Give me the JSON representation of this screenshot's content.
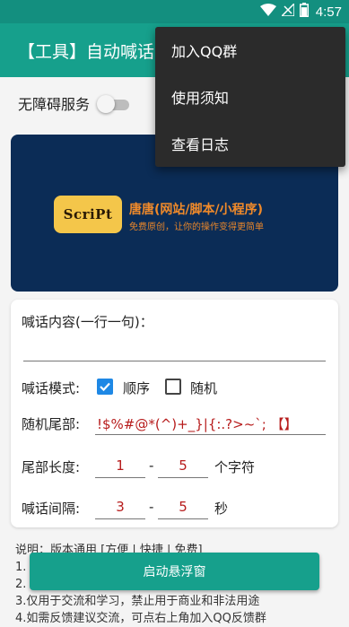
{
  "status_bar": {
    "time": "4:57",
    "battery_level": 0.75
  },
  "app_bar": {
    "title": "【工具】自动喊话"
  },
  "accessibility": {
    "label": "无障碍服务",
    "enabled": false
  },
  "banner": {
    "logo_text": "ScriPt",
    "title": "唐唐(网站/脚本/小程序)",
    "subtitle": "免费原创，让你的操作变得更简单"
  },
  "form": {
    "message_label": "喊话内容(一行一句)：",
    "message_value": "",
    "mode_label": "喊话模式:",
    "mode_options": [
      {
        "label": "顺序",
        "checked": true
      },
      {
        "label": "随机",
        "checked": false
      }
    ],
    "tail_label": "随机尾部:",
    "tail_value": "!$%#@*(^)+_}|{:.?>~`;  【】",
    "tail_length_label": "尾部长度:",
    "tail_length_min": "1",
    "tail_length_max": "5",
    "tail_length_unit": "个字符",
    "interval_label": "喊话间隔:",
    "interval_min": "3",
    "interval_max": "5",
    "interval_unit": "秒",
    "range_separator": "-"
  },
  "notes": [
    "说明：版本通用 [方便 | 快捷 | 免费]",
    "1.",
    "2.",
    "3.仅用于交流和学习，禁止用于商业和非法用途",
    "4.如需反馈建议交流，可点右上角加入QQ反馈群"
  ],
  "start_button": {
    "label": "启动悬浮窗"
  },
  "overflow_menu": {
    "items": [
      "加入QQ群",
      "使用须知",
      "查看日志"
    ]
  },
  "colors": {
    "primary": "#16a08c",
    "primary_dark": "#138f7f",
    "banner_bg": "#0b2c56",
    "accent_checkbox": "#1e88e5",
    "value_text": "#b71c1c"
  }
}
